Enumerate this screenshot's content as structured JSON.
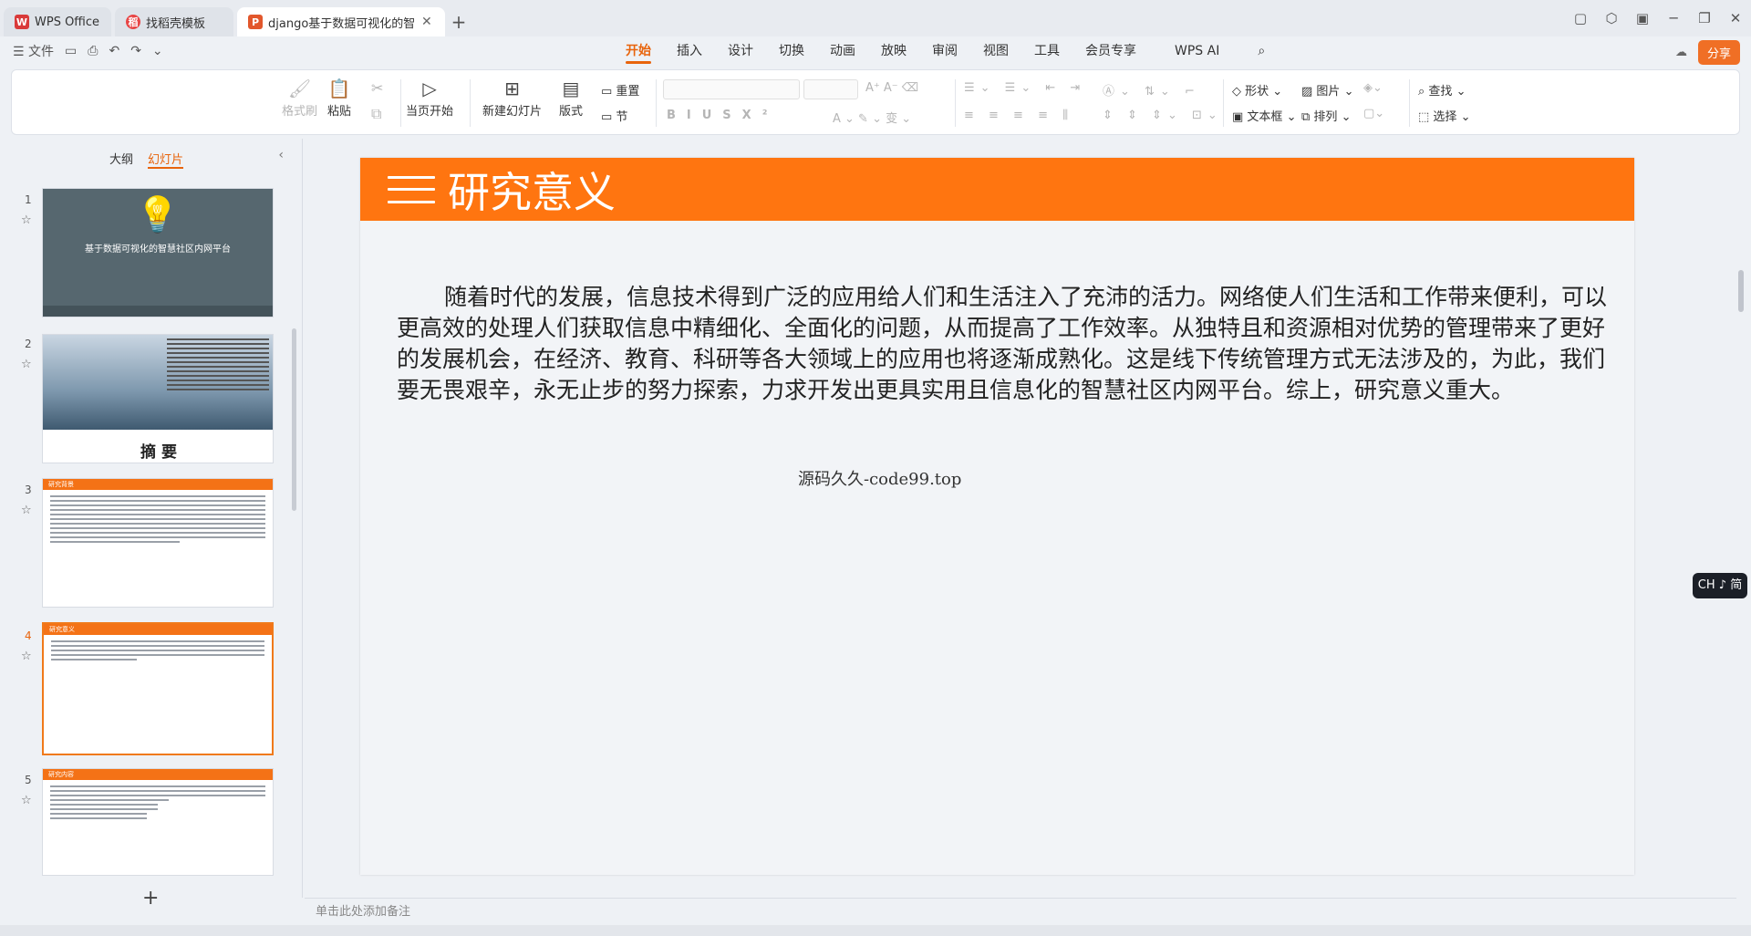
{
  "tabs": [
    {
      "label": "WPS Office",
      "icon": "wps-icon",
      "color": "#d93a3a"
    },
    {
      "label": "找稻壳模板",
      "icon": "docer-icon",
      "color": "#e84545"
    },
    {
      "label": "django基于数据可视化的智",
      "icon": "ppt-icon",
      "color": "#e2572c"
    }
  ],
  "menubar": {
    "file_label": "文件",
    "tabs": [
      "开始",
      "插入",
      "设计",
      "切换",
      "动画",
      "放映",
      "审阅",
      "视图",
      "工具",
      "会员专享"
    ],
    "active_tab": "开始",
    "ai_label": "WPS AI",
    "share_label": "分享"
  },
  "ribbon": {
    "format_painter": "格式刷",
    "paste": "粘贴",
    "play_from_current": "当页开始",
    "new_slide": "新建幻灯片",
    "layout": "版式",
    "reset": "重置",
    "section": "节",
    "shape": "形状",
    "picture": "图片",
    "textbox": "文本框",
    "arrange": "排列",
    "find": "查找",
    "select": "选择"
  },
  "left_panel": {
    "outline_tab": "大纲",
    "slides_tab": "幻灯片",
    "slides": [
      {
        "num": "1",
        "title": "基于数据可视化的智慧社区内网平台"
      },
      {
        "num": "2",
        "title": "摘  要"
      },
      {
        "num": "3",
        "title": "研究背景"
      },
      {
        "num": "4",
        "title": "研究意义"
      },
      {
        "num": "5",
        "title": "研究内容"
      }
    ]
  },
  "slide": {
    "title": "研究意义",
    "body": "随着时代的发展，信息技术得到广泛的应用给人们和生活注入了充沛的活力。网络使人们生活和工作带来便利，可以更高效的处理人们获取信息中精细化、全面化的问题，从而提高了工作效率。从独特且和资源相对优势的管理带来了更好的发展机会，在经济、教育、科研等各大领域上的应用也将逐渐成熟化。这是线下传统管理方式无法涉及的，为此，我们要无畏艰辛，永无止步的努力探索，力求开发出更具实用且信息化的智慧社区内网平台。综上，研究意义重大。",
    "source": "源码久久-code99.top",
    "accent": "#ff7510"
  },
  "notes_placeholder": "单击此处添加备注",
  "ime_label": "CH ♪ 简"
}
